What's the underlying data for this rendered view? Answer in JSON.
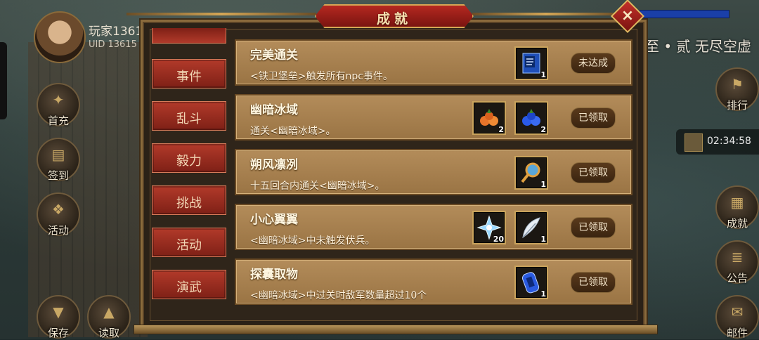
{
  "player": {
    "name": "玩家1361",
    "uid": "UID  13615"
  },
  "left_buttons": [
    {
      "label": "首充"
    },
    {
      "label": "签到"
    },
    {
      "label": "活动"
    },
    {
      "label": "保存"
    },
    {
      "label": "读取"
    }
  ],
  "right_buttons": [
    {
      "label": "排行"
    },
    {
      "label": "成就"
    },
    {
      "label": "公告"
    },
    {
      "label": "邮件"
    }
  ],
  "stage_text": "至 • 贰 无尽空虚",
  "timer": "02:34:58",
  "panel": {
    "title": "成就",
    "close_symbol": "×"
  },
  "tabs": [
    {
      "label": "事件"
    },
    {
      "label": "乱斗"
    },
    {
      "label": "毅力"
    },
    {
      "label": "挑战"
    },
    {
      "label": "活动"
    },
    {
      "label": "演武"
    }
  ],
  "achievements": [
    {
      "name": "完美通关",
      "desc": "<铁卫堡垒>触发所有npc事件。",
      "status": "未达成",
      "rewards": [
        {
          "icon": "blue-book-icon",
          "count": "1"
        }
      ]
    },
    {
      "name": "幽暗冰域",
      "desc": "通关<幽暗冰域>。",
      "status": "已领取",
      "rewards": [
        {
          "icon": "orange-fruit-icon",
          "count": "2"
        },
        {
          "icon": "blue-fruit-icon",
          "count": "2"
        }
      ]
    },
    {
      "name": "朔风凛冽",
      "desc": "十五回合内通关<幽暗冰域>。",
      "status": "已领取",
      "rewards": [
        {
          "icon": "magnifier-key-icon",
          "count": "1"
        }
      ]
    },
    {
      "name": "小心翼翼",
      "desc": "<幽暗冰域>中未触发伏兵。",
      "status": "已领取",
      "rewards": [
        {
          "icon": "ice-crystal-icon",
          "count": "20"
        },
        {
          "icon": "white-feather-icon",
          "count": "1"
        }
      ]
    },
    {
      "name": "探囊取物",
      "desc": "<幽暗冰域>中过关时敌军数量超过10个",
      "status": "已领取",
      "rewards": [
        {
          "icon": "blue-scroll-icon",
          "count": "1"
        }
      ]
    }
  ]
}
